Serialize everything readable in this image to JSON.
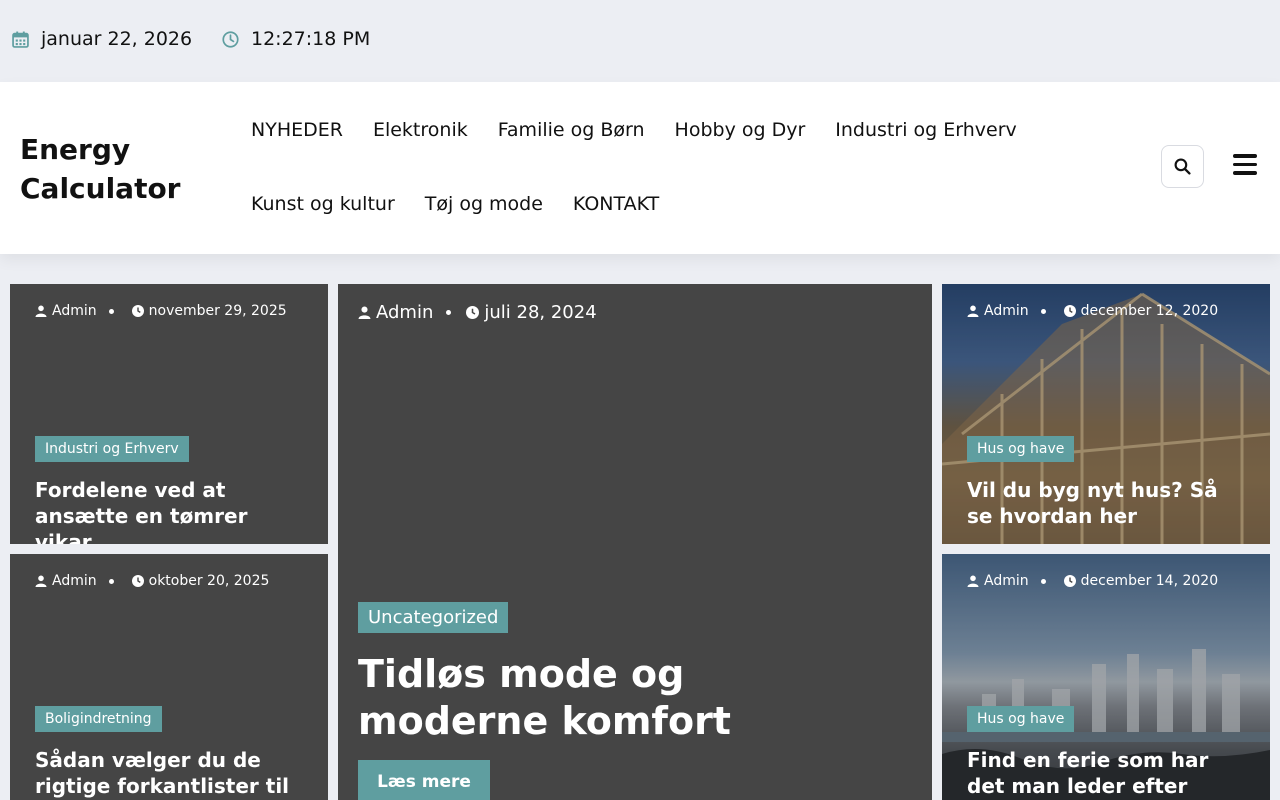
{
  "topbar": {
    "date": "januar 22, 2026",
    "time": "12:27:18 PM"
  },
  "header": {
    "logo_line1": "Energy",
    "logo_line2": "Calculator",
    "nav_row1": [
      "NYHEDER",
      "Elektronik",
      "Familie og Børn",
      "Hobby og Dyr",
      "Industri og Erhverv"
    ],
    "nav_row2": [
      "Kunst og kultur",
      "Tøj og mode",
      "KONTAKT"
    ]
  },
  "icons": {
    "date": "calendar-icon",
    "time": "clock-icon",
    "search": "search-icon",
    "menu": "hamburger-icon",
    "author": "user-icon"
  },
  "colors": {
    "accent": "#5f9ea0",
    "card_bg": "#454545",
    "page_bg": "#eceef3"
  },
  "cards": [
    {
      "author": "Admin",
      "date": "november 29, 2025",
      "category": "Industri og Erhverv",
      "title": "Fordelene ved at ansætte en tømrer vikar"
    },
    {
      "author": "Admin",
      "date": "oktober 20, 2025",
      "category": "Boligindretning",
      "title": "Sådan vælger du de rigtige forkantlister til di…"
    },
    {
      "author": "Admin",
      "date": "juli 28, 2024",
      "category": "Uncategorized",
      "title": "Tidløs mode og moderne komfort",
      "button": "Læs mere"
    },
    {
      "author": "Admin",
      "date": "december 12, 2020",
      "category": "Hus og have",
      "title": "Vil du byg nyt hus? Så se hvordan her"
    },
    {
      "author": "Admin",
      "date": "december 14, 2020",
      "category": "Hus og have",
      "title": "Find en ferie som har det man leder efter"
    }
  ]
}
